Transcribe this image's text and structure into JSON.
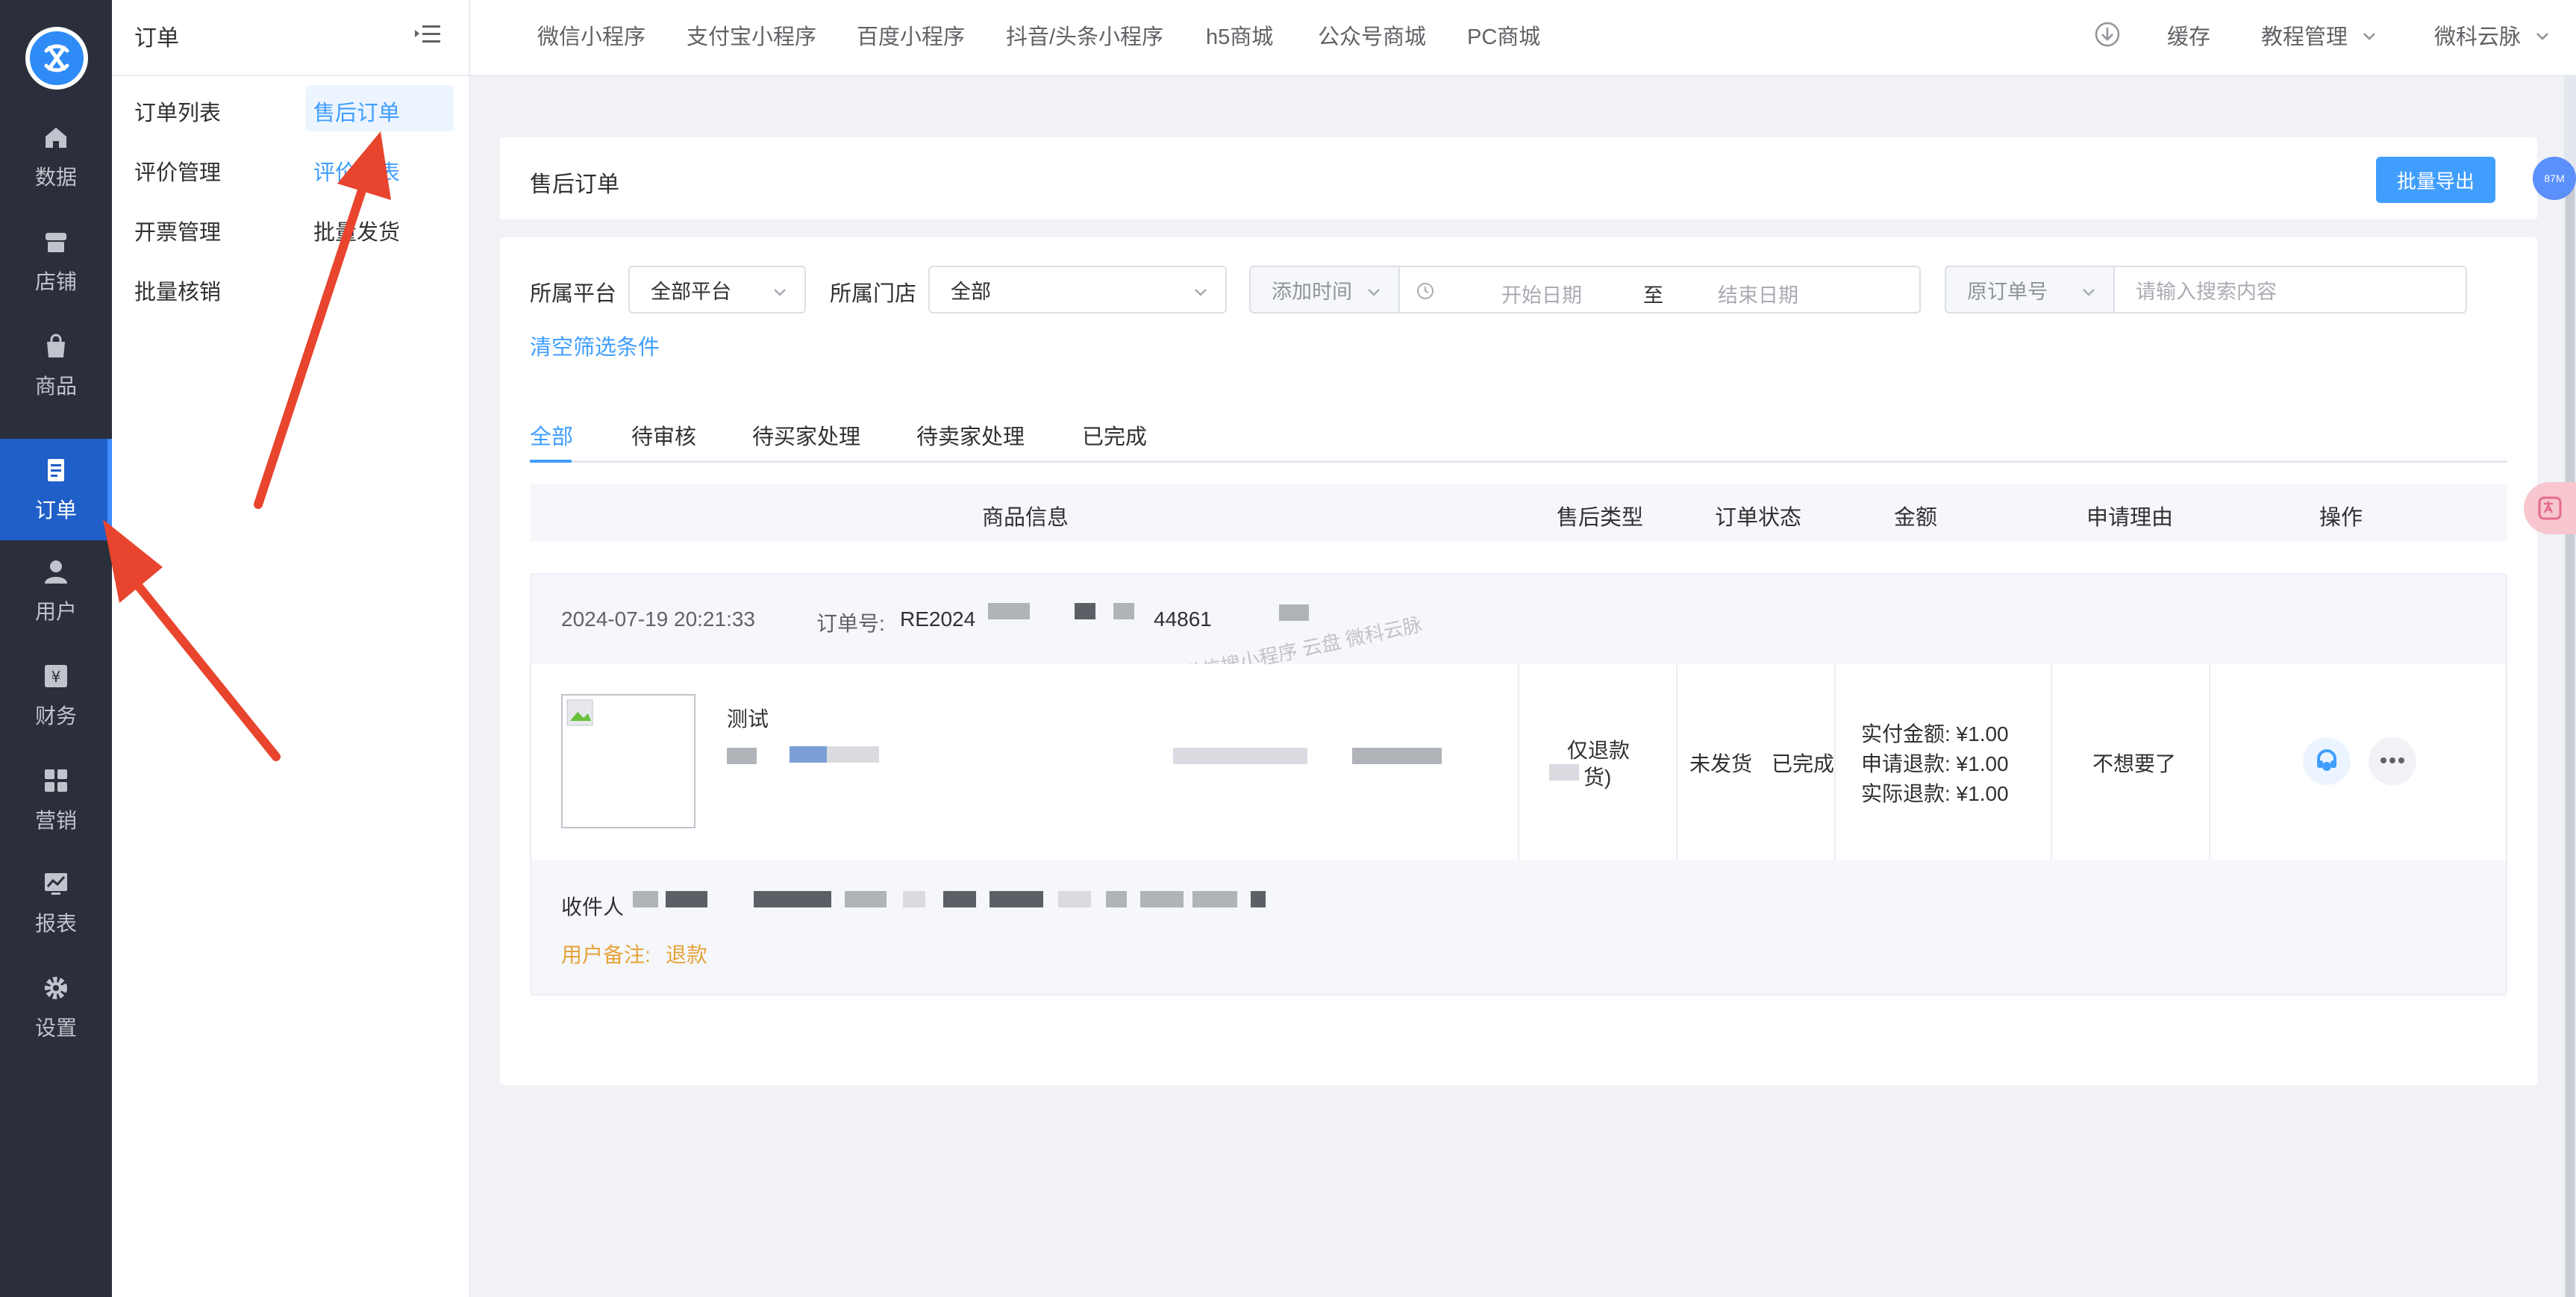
{
  "rail": {
    "items": [
      {
        "label": "数据",
        "icon": "home-icon"
      },
      {
        "label": "店铺",
        "icon": "store-icon"
      },
      {
        "label": "商品",
        "icon": "bag-icon"
      },
      {
        "label": "订单",
        "icon": "order-icon"
      },
      {
        "label": "用户",
        "icon": "user-icon"
      },
      {
        "label": "财务",
        "icon": "yen-icon"
      },
      {
        "label": "营销",
        "icon": "grid-icon"
      },
      {
        "label": "报表",
        "icon": "chart-icon"
      },
      {
        "label": "设置",
        "icon": "gear-icon"
      }
    ],
    "active_index": 3
  },
  "submenu": {
    "title": "订单",
    "col1": [
      "订单列表",
      "评价管理",
      "开票管理",
      "批量核销"
    ],
    "col2": [
      "售后订单",
      "评价列表",
      "批量发货"
    ],
    "col2_active_index": 0
  },
  "topbar": {
    "tabs": [
      "微信小程序",
      "支付宝小程序",
      "百度小程序",
      "抖音/头条小程序",
      "h5商城",
      "公众号商城",
      "PC商城"
    ],
    "cache": "缓存",
    "tutorial": "教程管理",
    "account": "微科云脉"
  },
  "header": {
    "title": "售后订单",
    "export": "批量导出"
  },
  "filters": {
    "platform_label": "所属平台",
    "platform_value": "全部平台",
    "store_label": "所属门店",
    "store_value": "全部",
    "time_type": "添加时间",
    "start_placeholder": "开始日期",
    "range_sep": "至",
    "end_placeholder": "结束日期",
    "search_type": "原订单号",
    "search_placeholder": "请输入搜索内容",
    "clear": "清空筛选条件"
  },
  "tabs": [
    "全部",
    "待审核",
    "待买家处理",
    "待卖家处理",
    "已完成"
  ],
  "active_tab": 0,
  "table": {
    "headers": [
      "商品信息",
      "售后类型",
      "订单状态",
      "金额",
      "申请理由",
      "操作"
    ]
  },
  "order": {
    "time": "2024-07-19 20:21:33",
    "order_no_label": "订单号:",
    "order_no_start": "RE2024",
    "order_no_end": "44861",
    "watermark": "微信搜小程序 云盘 微科云脉",
    "product_name": "测试",
    "aftersale_type_line1": "仅退款",
    "aftersale_type_line2": "货)",
    "ship_status": "未发货",
    "order_status": "已完成",
    "paid": "实付金额: ¥1.00",
    "apply_refund": "申请退款: ¥1.00",
    "actual_refund": "实际退款: ¥1.00",
    "reason": "不想要了",
    "receiver_label": "收件人",
    "remark_label": "用户备注:",
    "remark_value": "退款"
  },
  "float_badge": "87M",
  "colors": {
    "primary": "#409eff",
    "sidebar": "#2a2f3b",
    "active_rail": "#1f5fc8",
    "remark": "#e6a23c",
    "arrow": "#e8442e"
  }
}
